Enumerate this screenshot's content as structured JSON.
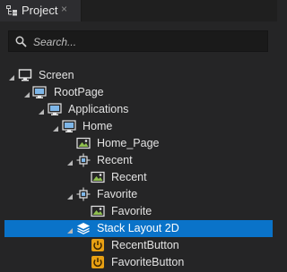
{
  "tab": {
    "title": "Project",
    "close_glyph": "×"
  },
  "search": {
    "placeholder": "Search..."
  },
  "tree": [
    {
      "label": "Screen",
      "icon": "monitor-icon",
      "expanded": true
    },
    {
      "label": "RootPage",
      "icon": "page-icon",
      "expanded": true
    },
    {
      "label": "Applications",
      "icon": "page-icon",
      "expanded": true
    },
    {
      "label": "Home",
      "icon": "page-icon",
      "expanded": true
    },
    {
      "label": "Home_Page",
      "icon": "image-icon",
      "expanded": null
    },
    {
      "label": "Recent",
      "icon": "node-icon",
      "expanded": true
    },
    {
      "label": "Recent",
      "icon": "image-icon",
      "expanded": null
    },
    {
      "label": "Favorite",
      "icon": "node-icon",
      "expanded": true
    },
    {
      "label": "Favorite",
      "icon": "image-icon",
      "expanded": null
    },
    {
      "label": "Stack Layout 2D",
      "icon": "layers-icon",
      "expanded": true,
      "selected": true
    },
    {
      "label": "RecentButton",
      "icon": "button-icon",
      "expanded": null
    },
    {
      "label": "FavoriteButton",
      "icon": "button-icon",
      "expanded": null
    }
  ],
  "colors": {
    "selection": "#0a73c9",
    "button_icon": "#e8a013",
    "image_icon": "#8fbf4f",
    "page_icon": "#7eb6e8"
  }
}
